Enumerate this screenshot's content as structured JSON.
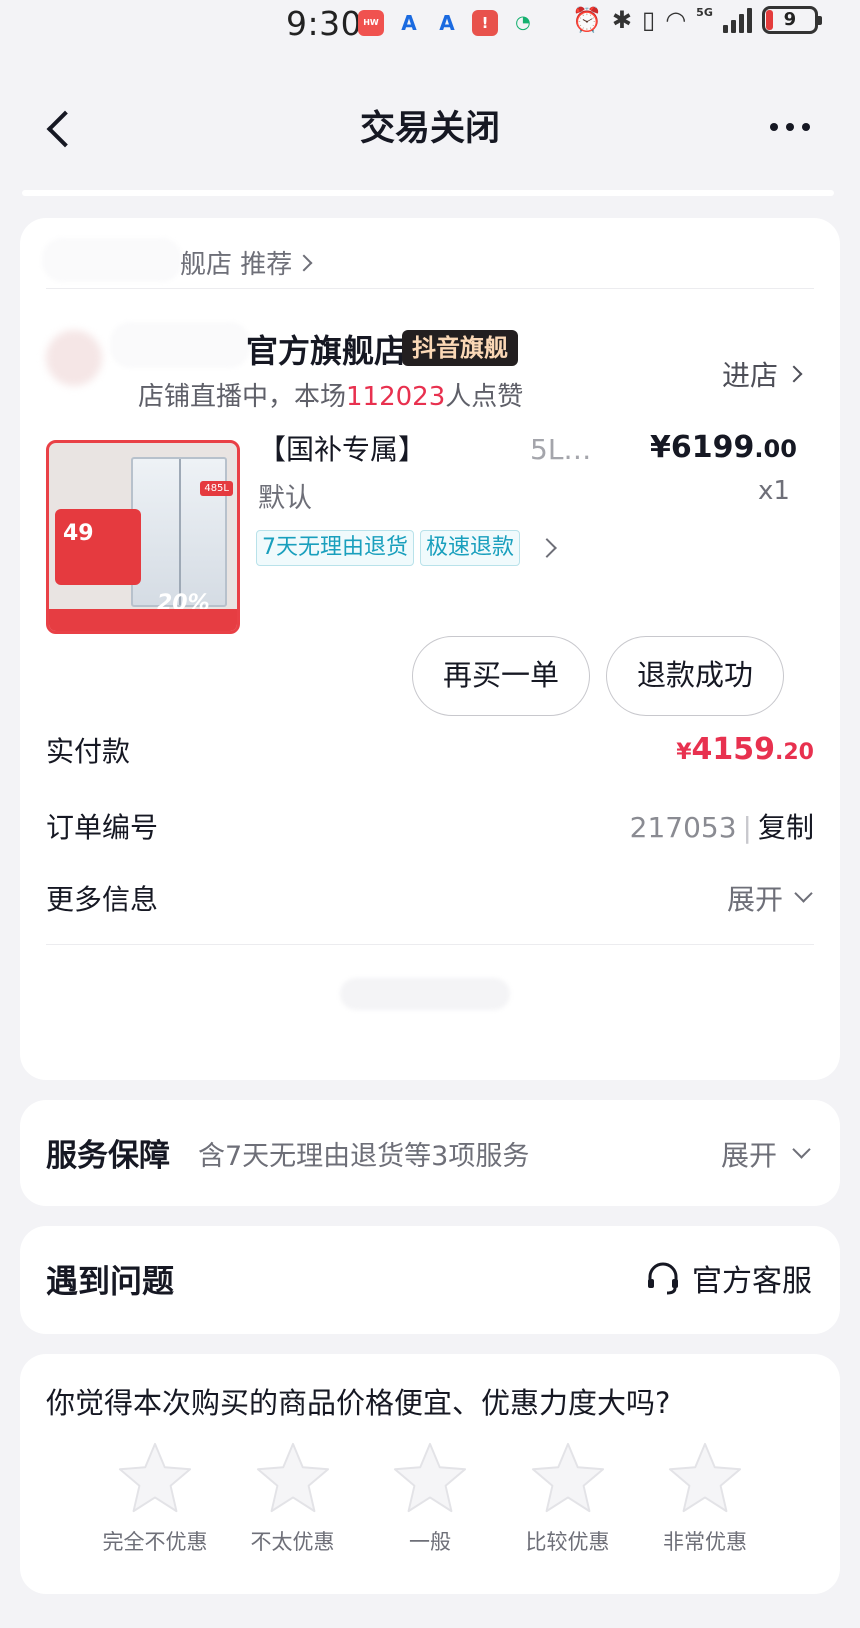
{
  "status_bar": {
    "time": "9:30",
    "net": "5G",
    "battery": "9"
  },
  "nav": {
    "title": "交易关闭"
  },
  "order": {
    "shop_recommend": "舰店 推荐",
    "shop_name": "官方旗舰店",
    "shop_badge": "抖音旗舰",
    "live_prefix": "店铺直播中，本场",
    "live_count": "112023",
    "live_suffix": "人点赞",
    "enter_shop": "进店",
    "product": {
      "title": "【国补专属】",
      "title_rest": "5L…",
      "price_int": "¥6199",
      "price_dec": ".00",
      "spec": "默认",
      "qty": "x1",
      "tags": [
        "7天无理由退货",
        "极速退款"
      ],
      "image_text_price": "49",
      "image_text_pct": "20%",
      "image_text_cap": "485L"
    },
    "buttons": {
      "rebuy": "再买一单",
      "refund": "退款成功"
    },
    "paid_label": "实付款",
    "paid_currency": "¥",
    "paid_int": "4159",
    "paid_dec": ".20",
    "order_no_label": "订单编号",
    "order_no_tail": "217053",
    "copy": "复制",
    "more_info_label": "更多信息",
    "expand": "展开"
  },
  "service": {
    "title": "服务保障",
    "desc": "含7天无理由退货等3项服务",
    "expand": "展开"
  },
  "problem": {
    "title": "遇到问题",
    "customer_service": "官方客服"
  },
  "survey": {
    "question": "你觉得本次购买的商品价格便宜、优惠力度大吗?",
    "options": [
      "完全不优惠",
      "不太优惠",
      "一般",
      "比较优惠",
      "非常优惠"
    ]
  }
}
